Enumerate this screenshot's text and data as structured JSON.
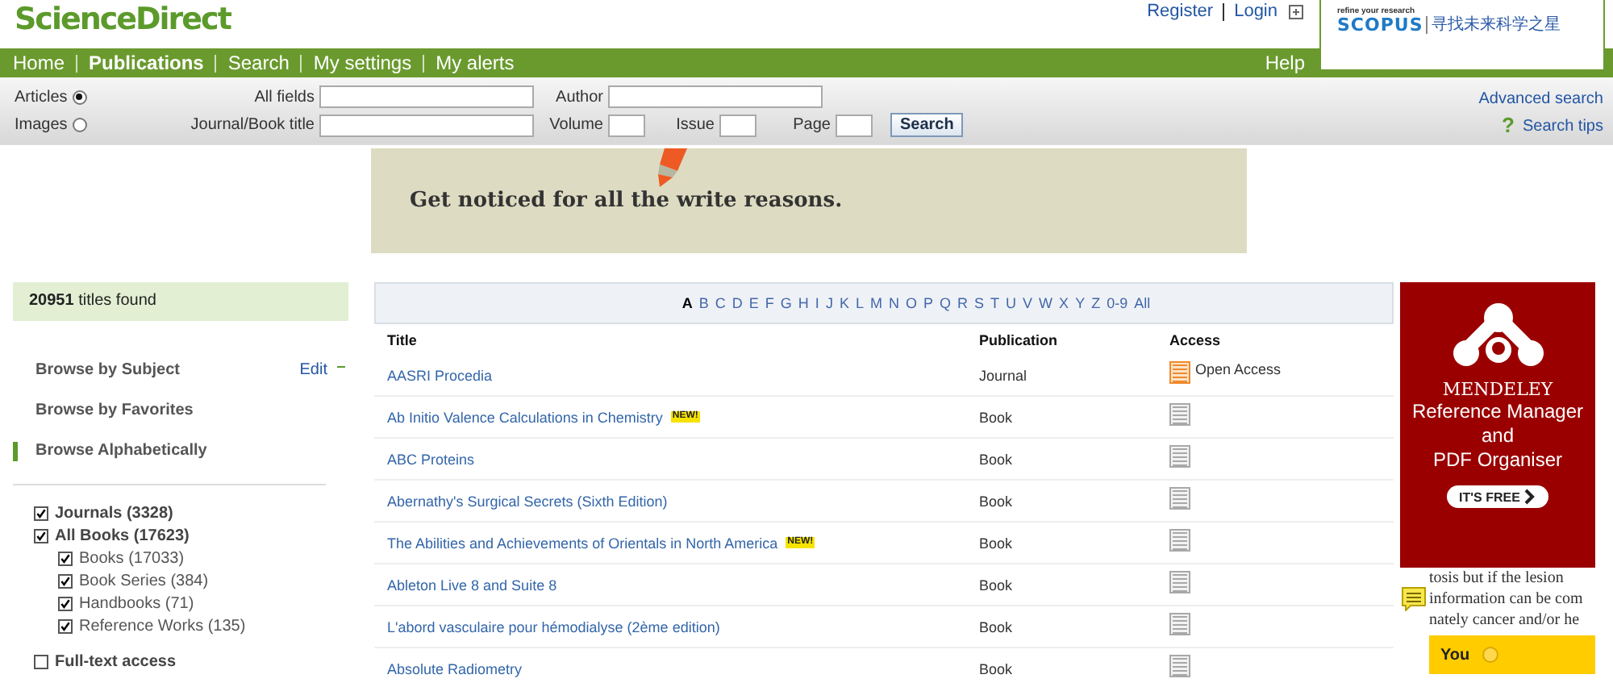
{
  "header": {
    "logo": "ScienceDirect",
    "links": [
      "Register",
      "Login"
    ],
    "scopus": {
      "tagline": "refine your research",
      "brand": "SCOPUS",
      "slogan": "寻找未来科学之星"
    }
  },
  "nav": {
    "items": [
      {
        "label": "Home",
        "selected": false
      },
      {
        "label": "Publications",
        "selected": true
      },
      {
        "label": "Search",
        "selected": false
      },
      {
        "label": "My settings",
        "selected": false
      },
      {
        "label": "My alerts",
        "selected": false
      }
    ],
    "help": "Help"
  },
  "search": {
    "types": [
      {
        "label": "Articles",
        "selected": true
      },
      {
        "label": "Images",
        "selected": false
      }
    ],
    "all_fields": "All fields",
    "author": "Author",
    "journal_title": "Journal/Book title",
    "volume": "Volume",
    "issue": "Issue",
    "page": "Page",
    "button": "Search",
    "advanced": "Advanced search",
    "tips_icon": "?",
    "tips": "Search tips"
  },
  "banner": {
    "text": "Get noticed for all the write reasons."
  },
  "sidebar": {
    "count": "20951",
    "count_label": "titles found",
    "browse": [
      {
        "label": "Browse by Subject",
        "selected": false
      },
      {
        "label": "Browse by Favorites",
        "selected": false
      },
      {
        "label": "Browse Alphabetically",
        "selected": true
      }
    ],
    "edit": "Edit",
    "filters": [
      {
        "label": "Journals (3328)",
        "checked": true
      },
      {
        "label": "All Books  (17623)",
        "checked": true,
        "children": [
          {
            "label": "Books (17033)",
            "checked": true
          },
          {
            "label": "Book Series (384)",
            "checked": true
          },
          {
            "label": "Handbooks (71)",
            "checked": true
          },
          {
            "label": "Reference Works (135)",
            "checked": true
          }
        ]
      }
    ],
    "fulltext": {
      "label": "Full-text access",
      "checked": false
    }
  },
  "alphabet": [
    {
      "label": "A",
      "selected": true
    },
    {
      "label": "B",
      "selected": false
    },
    {
      "label": "C",
      "selected": false
    },
    {
      "label": "D",
      "selected": false
    },
    {
      "label": "E",
      "selected": false
    },
    {
      "label": "F",
      "selected": false
    },
    {
      "label": "G",
      "selected": false
    },
    {
      "label": "H",
      "selected": false
    },
    {
      "label": "I",
      "selected": false
    },
    {
      "label": "J",
      "selected": false
    },
    {
      "label": "K",
      "selected": false
    },
    {
      "label": "L",
      "selected": false
    },
    {
      "label": "M",
      "selected": false
    },
    {
      "label": "N",
      "selected": false
    },
    {
      "label": "O",
      "selected": false
    },
    {
      "label": "P",
      "selected": false
    },
    {
      "label": "Q",
      "selected": false
    },
    {
      "label": "R",
      "selected": false
    },
    {
      "label": "S",
      "selected": false
    },
    {
      "label": "T",
      "selected": false
    },
    {
      "label": "U",
      "selected": false
    },
    {
      "label": "V",
      "selected": false
    },
    {
      "label": "W",
      "selected": false
    },
    {
      "label": "X",
      "selected": false
    },
    {
      "label": "Y",
      "selected": false
    },
    {
      "label": "Z",
      "selected": false
    },
    {
      "label": "0-9",
      "selected": false
    },
    {
      "label": "All",
      "selected": false
    }
  ],
  "table": {
    "columns": [
      "Title",
      "Publication",
      "Access"
    ],
    "rows": [
      {
        "title": "AASRI Procedia",
        "publication": "Journal",
        "open_access": true,
        "access_text": "Open Access"
      },
      {
        "title": "Ab Initio Valence Calculations in Chemistry",
        "badge": "NEW!",
        "publication": "Book",
        "open_access": false
      },
      {
        "title": "ABC Proteins",
        "publication": "Book",
        "open_access": false
      },
      {
        "title": "Abernathy's Surgical Secrets (Sixth Edition)",
        "publication": "Book",
        "open_access": false
      },
      {
        "title": "The Abilities and Achievements of Orientals in North America",
        "badge": "NEW!",
        "publication": "Book",
        "open_access": false
      },
      {
        "title": "Ableton Live 8 and Suite 8",
        "publication": "Book",
        "open_access": false
      },
      {
        "title": "L'abord vasculaire pour hémodialyse (2ème edition)",
        "publication": "Book",
        "open_access": false
      },
      {
        "title": "Absolute Radiometry",
        "publication": "Book",
        "open_access": false
      }
    ]
  },
  "ad": {
    "brand": "MENDELEY",
    "lines": [
      "Reference Manager",
      "and",
      "PDF Organiser"
    ],
    "button": "IT'S FREE"
  },
  "popup": {
    "lines": [
      "tosis but if the lesion",
      "information can be com",
      "nately cancer and/or he"
    ],
    "bar": "You"
  }
}
